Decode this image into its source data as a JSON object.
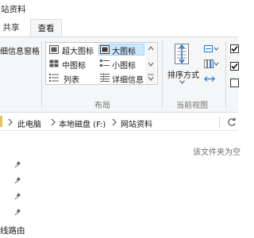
{
  "window": {
    "title": "站资料"
  },
  "tabs": {
    "share": "共享",
    "view": "查看"
  },
  "ribbon": {
    "pane_item": "细信息窗格",
    "layout": {
      "extra_large_icons": "超大图标",
      "large_icons": "大图标",
      "medium_icons": "中图标",
      "small_icons": "小图标",
      "list": "列表",
      "details": "详细信息",
      "group_label": "布局"
    },
    "current_view": {
      "sort_by": "排序方式",
      "group_label": "当前视图"
    }
  },
  "address": {
    "crumbs": [
      "此电脑",
      "本地磁盘 (F:)",
      "网站资料"
    ],
    "refresh_icon": "refresh-icon"
  },
  "content": {
    "empty_message": "该文件夹为空"
  },
  "nav_pane": {
    "pinned_count": 4,
    "router_item": "线路由"
  }
}
